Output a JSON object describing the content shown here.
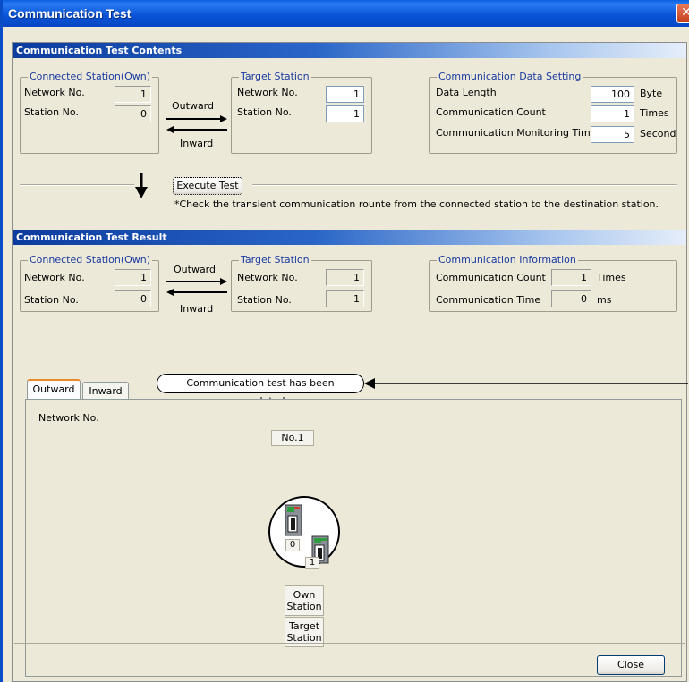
{
  "window": {
    "title": "Communication Test",
    "close_glyph": "✕"
  },
  "contents": {
    "header": "Communication Test Contents",
    "own": {
      "legend": "Connected Station(Own)",
      "network_label": "Network No.",
      "network_value": "1",
      "station_label": "Station No.",
      "station_value": "0"
    },
    "outward_label": "Outward",
    "inward_label": "Inward",
    "target": {
      "legend": "Target Station",
      "network_label": "Network No.",
      "network_value": "1",
      "station_label": "Station No.",
      "station_value": "1"
    },
    "data_setting": {
      "legend": "Communication Data Setting",
      "length_label": "Data Length",
      "length_value": "100",
      "length_unit": "Byte",
      "count_label": "Communication Count",
      "count_value": "1",
      "count_unit": "Times",
      "monitor_label": "Communication Monitoring Time",
      "monitor_value": "5",
      "monitor_unit": "Second"
    },
    "execute_label": "Execute Test",
    "note": "*Check the transient communication rounte from the connected station to the destination station."
  },
  "result": {
    "header": "Communication Test Result",
    "own": {
      "legend": "Connected Station(Own)",
      "network_label": "Network No.",
      "network_value": "1",
      "station_label": "Station No.",
      "station_value": "0"
    },
    "outward_label": "Outward",
    "inward_label": "Inward",
    "target": {
      "legend": "Target Station",
      "network_label": "Network No.",
      "network_value": "1",
      "station_label": "Station No.",
      "station_value": "1"
    },
    "info": {
      "legend": "Communication Information",
      "count_label": "Communication Count",
      "count_value": "1",
      "count_unit": "Times",
      "time_label": "Communication Time",
      "time_value": "0",
      "time_unit": "ms"
    }
  },
  "tabs": {
    "outward": "Outward",
    "inward": "Inward"
  },
  "status_message": "Communication test has been completed.",
  "diagram": {
    "network_label": "Network No.",
    "network_tag": "No.1",
    "own_station_no": "0",
    "target_station_no": "1",
    "legend_own": "Own Station",
    "legend_target": "Target Station"
  },
  "close_label": "Close",
  "colors": {
    "title_bar": "#0a54d8",
    "header_start": "#0c3b9e",
    "legend_text": "#1a3aa0"
  }
}
